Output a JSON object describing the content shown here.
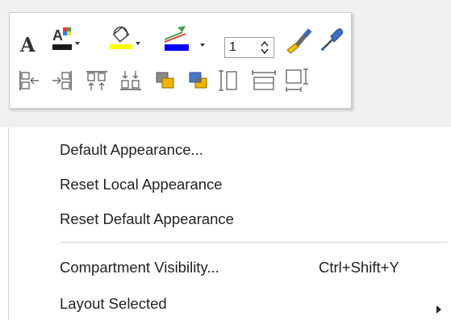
{
  "toolbar": {
    "row1": {
      "font_icon": "font-icon",
      "font_color_icon": "font-color-icon",
      "fill_color_icon": "fill-bucket-icon",
      "line_color_icon": "line-color-icon",
      "line_width_value": "1",
      "format_painter_icon": "format-painter-icon",
      "pick_color_icon": "eyedropper-icon"
    },
    "row2": [
      "align-left-icon",
      "align-right-icon",
      "align-top-icon",
      "align-bottom-icon",
      "bring-to-front-icon",
      "send-to-back-icon",
      "same-height-icon",
      "same-width-icon",
      "same-size-icon"
    ],
    "colors": {
      "font_swatch": "#1a1a1a",
      "fill_swatch": "#ffff00",
      "line_swatch": "#0000ff"
    }
  },
  "menu": {
    "items": [
      {
        "label": "Default Appearance..."
      },
      {
        "label": "Reset Local Appearance"
      },
      {
        "label": "Reset Default Appearance"
      },
      {
        "label": "Compartment Visibility...",
        "shortcut": "Ctrl+Shift+Y"
      },
      {
        "label": "Layout Selected",
        "has_submenu": true
      }
    ]
  }
}
